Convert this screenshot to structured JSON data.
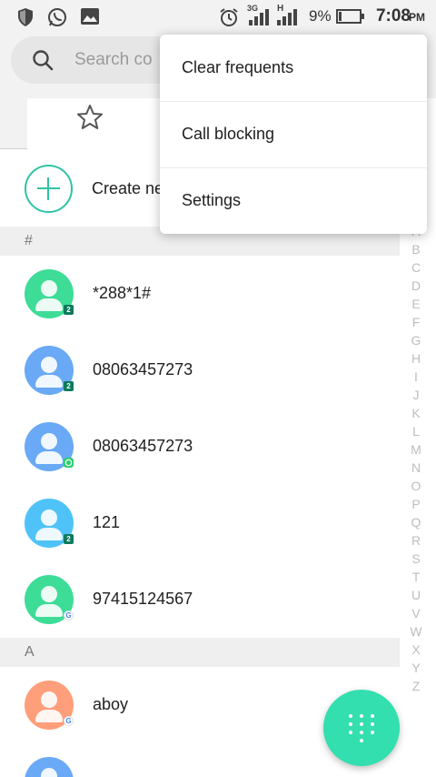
{
  "status_bar": {
    "icons": [
      "shield-icon",
      "whatsapp-icon",
      "image-icon",
      "alarm-icon",
      "signal-3g-icon",
      "signal-h-icon",
      "battery-icon"
    ],
    "network_3g": "3G",
    "network_h": "H",
    "battery_text": "9%",
    "time": "7:08",
    "ampm": "PM"
  },
  "search": {
    "placeholder": "Search co"
  },
  "tabs": {
    "favorites_icon": "star-icon"
  },
  "create": {
    "label": "Create ne"
  },
  "sections": [
    {
      "header": "#",
      "contacts": [
        {
          "name": "*288*1#",
          "avatar_color": "#3ddc97",
          "badge": "sim",
          "badge_text": "2"
        },
        {
          "name": "08063457273",
          "avatar_color": "#6aa9f5",
          "badge": "sim",
          "badge_text": "2"
        },
        {
          "name": "08063457273",
          "avatar_color": "#6aa9f5",
          "badge": "whatsapp",
          "badge_text": ""
        },
        {
          "name": "121",
          "avatar_color": "#4fc3f7",
          "badge": "sim",
          "badge_text": "2"
        },
        {
          "name": "97415124567",
          "avatar_color": "#3ddc97",
          "badge": "google",
          "badge_text": "G"
        }
      ]
    },
    {
      "header": "A",
      "contacts": [
        {
          "name": "aboy",
          "avatar_color": "#ff9e7a",
          "badge": "google",
          "badge_text": "G"
        }
      ]
    }
  ],
  "index_letters": [
    "A",
    "B",
    "C",
    "D",
    "E",
    "F",
    "G",
    "H",
    "I",
    "J",
    "K",
    "L",
    "M",
    "N",
    "O",
    "P",
    "Q",
    "R",
    "S",
    "T",
    "U",
    "V",
    "W",
    "X",
    "Y",
    "Z"
  ],
  "menu": {
    "items": [
      "Clear frequents",
      "Call blocking",
      "Settings"
    ]
  },
  "fab": {
    "icon": "dialpad-icon",
    "color": "#33dfae"
  },
  "colors": {
    "accent": "#2ec4a4"
  }
}
